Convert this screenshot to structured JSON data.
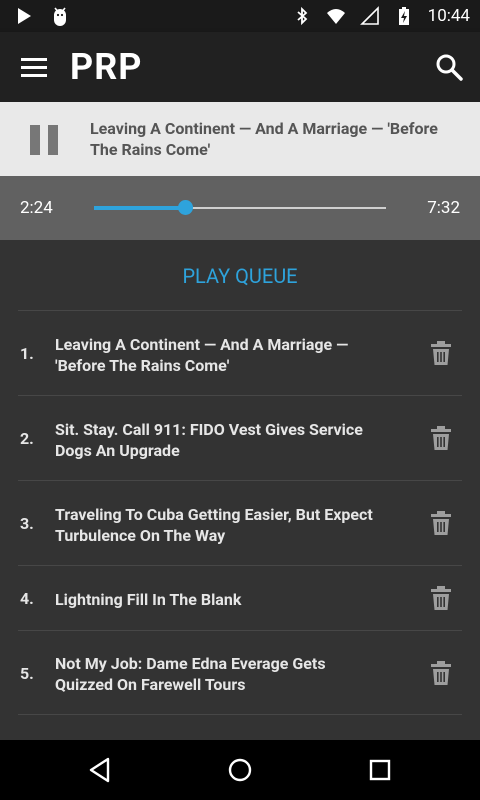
{
  "status_bar": {
    "time": "10:44",
    "icons": [
      "play-icon",
      "android-debug-icon",
      "bluetooth-icon",
      "wifi-icon",
      "signal-icon",
      "battery-charging-icon"
    ]
  },
  "app_bar": {
    "title": "PRP",
    "menu_icon": "hamburger-menu-icon",
    "search_icon": "search-icon"
  },
  "now_playing": {
    "title": "Leaving A Continent — And A Marriage — 'Before The Rains Come'",
    "control_icon": "pause-icon"
  },
  "seek": {
    "elapsed": "2:24",
    "duration": "7:32",
    "progress_fraction": 0.31,
    "accent_color": "#2ea3dc"
  },
  "queue": {
    "heading": "PLAY QUEUE",
    "items": [
      {
        "number": "1.",
        "title": "Leaving A Continent — And A Marriage — 'Before The Rains Come'"
      },
      {
        "number": "2.",
        "title": "Sit. Stay. Call 911: FIDO Vest Gives Service Dogs An Upgrade"
      },
      {
        "number": "3.",
        "title": "Traveling To Cuba Getting Easier, But Expect Turbulence On The Way"
      },
      {
        "number": "4.",
        "title": "Lightning Fill In The Blank"
      },
      {
        "number": "5.",
        "title": "Not My Job: Dame Edna Everage Gets Quizzed On Farewell Tours"
      }
    ],
    "delete_icon": "trash-icon"
  },
  "nav_bar": {
    "icons": [
      "back-icon",
      "home-icon",
      "recents-icon"
    ]
  }
}
